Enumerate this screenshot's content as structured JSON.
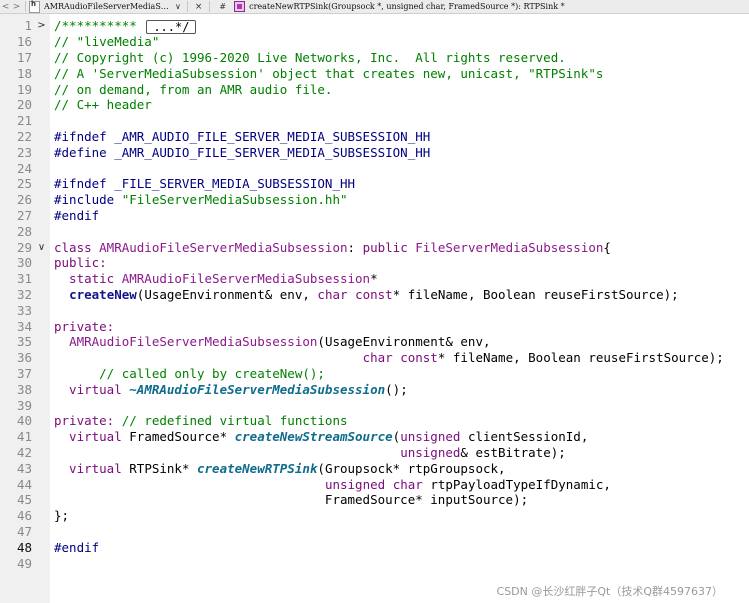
{
  "tabbar": {
    "nav_back": "<",
    "nav_forward": ">",
    "file_tab": "AMRAudioFileServerMediaS…",
    "dropdown": "∨",
    "close": "×",
    "symbol_hash": "#",
    "function_signature": "createNewRTPSink(Groupsock *, unsigned char, FramedSource *): RTPSink *"
  },
  "gutter": {
    "line_numbers": [
      "1",
      "16",
      "17",
      "18",
      "19",
      "20",
      "21",
      "22",
      "23",
      "24",
      "25",
      "26",
      "27",
      "28",
      "29",
      "30",
      "31",
      "32",
      "33",
      "34",
      "35",
      "36",
      "37",
      "38",
      "39",
      "40",
      "41",
      "42",
      "43",
      "44",
      "45",
      "46",
      "47",
      "48",
      "49"
    ],
    "current_line": "48",
    "fold_collapsed": ">",
    "fold_expanded": "∨"
  },
  "code": {
    "line1_prefix": "/**********",
    "line1_fold": "...*/",
    "line16": "// \"liveMedia\"",
    "line17": "// Copyright (c) 1996-2020 Live Networks, Inc.  All rights reserved.",
    "line18": "// A 'ServerMediaSubsession' object that creates new, unicast, \"RTPSink\"s",
    "line19": "// on demand, from an AMR audio file.",
    "line20": "// C++ header",
    "line22": "#ifndef _AMR_AUDIO_FILE_SERVER_MEDIA_SUBSESSION_HH",
    "line23": "#define _AMR_AUDIO_FILE_SERVER_MEDIA_SUBSESSION_HH",
    "line25": "#ifndef _FILE_SERVER_MEDIA_SUBSESSION_HH",
    "line26_directive": "#include ",
    "line26_string": "\"FileServerMediaSubsession.hh\"",
    "line27": "#endif",
    "line29_class": "class ",
    "line29_name": "AMRAudioFileServerMediaSubsession",
    "line29_colon": ": ",
    "line29_public": "public ",
    "line29_base": "FileServerMediaSubsession",
    "line29_brace": "{",
    "line30": "public:",
    "line31_static": "  static ",
    "line31_type": "AMRAudioFileServerMediaSubsession",
    "line31_star": "*",
    "line32_indent": "  ",
    "line32_fn": "createNew",
    "line32_p1": "(UsageEnvironment& env, ",
    "line32_char": "char",
    "line32_sp": " ",
    "line32_const": "const",
    "line32_p2": "* fileName, Boolean reuseFirstSource);",
    "line34": "private:",
    "line35_indent": "  ",
    "line35_fn": "AMRAudioFileServerMediaSubsession",
    "line35_rest": "(UsageEnvironment& env,",
    "line36_indent": "                                         ",
    "line36_char": "char",
    "line36_sp": " ",
    "line36_const": "const",
    "line36_rest": "* fileName, Boolean reuseFirstSource);",
    "line37": "      // called only by createNew();",
    "line38_virtual": "  virtual ",
    "line38_dtor": "~AMRAudioFileServerMediaSubsession",
    "line38_rest": "();",
    "line40_private": "private:",
    "line40_comment": " // redefined virtual functions",
    "line41_virtual": "  virtual ",
    "line41_type": "FramedSource* ",
    "line41_fn": "createNewStreamSource",
    "line41_p1": "(",
    "line41_unsigned": "unsigned",
    "line41_rest": " clientSessionId,",
    "line42_indent": "                                              ",
    "line42_unsigned": "unsigned",
    "line42_rest": "& estBitrate);",
    "line43_virtual": "  virtual ",
    "line43_type": "RTPSink* ",
    "line43_fn": "createNewRTPSink",
    "line43_rest": "(Groupsock* rtpGroupsock,",
    "line44_indent": "                                    ",
    "line44_unsigned": "unsigned",
    "line44_sp": " ",
    "line44_char": "char",
    "line44_rest": " rtpPayloadTypeIfDynamic,",
    "line45": "                                    FramedSource* inputSource);",
    "line46": "};",
    "line48": "#endif"
  },
  "watermark": "CSDN @长沙红胖子Qt（技术Q群4597637）",
  "colors": {
    "comment": "#008000",
    "keyword": "#7a0c7a",
    "function": "#14148a",
    "virtual_function": "#0e6c8c",
    "macro": "#000080",
    "gutter_bg": "#f0f0f0"
  }
}
